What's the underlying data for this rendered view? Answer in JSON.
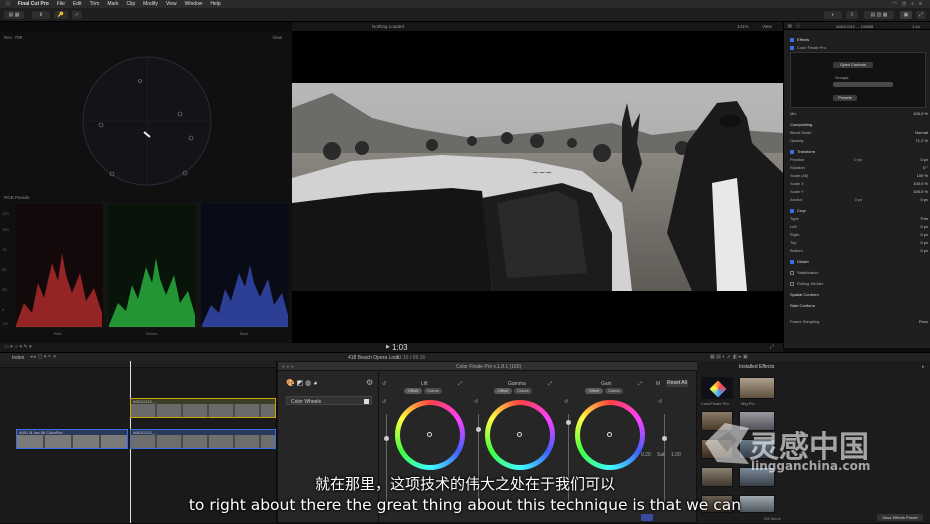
{
  "menubar": {
    "app": "Final Cut Pro",
    "items": [
      "File",
      "Edit",
      "Trim",
      "Mark",
      "Clip",
      "Modify",
      "View",
      "Window",
      "Help"
    ]
  },
  "viewer": {
    "status": "Nothing Loaded",
    "zoom": "141%",
    "view_label": "View",
    "timecode": "1:03"
  },
  "scopes": {
    "vectorscope_label": "Rec. 709",
    "vectorscope_view": "View",
    "parade_label": "RGB Parade",
    "ticks": [
      "120",
      "100",
      "75",
      "50",
      "25",
      "0",
      "-20"
    ],
    "channels": [
      "Red",
      "Green",
      "Blue"
    ]
  },
  "inspector": {
    "title": "A001C012 ... 100MB",
    "duration": "1:14",
    "effects_label": "Effects",
    "plugin_name": "Color Finale Pro",
    "open_controls": "Open Controls",
    "groups_label": "Groups:",
    "presets_label": "Presets",
    "mix_label": "Mix",
    "mix_value": "100.0 %",
    "compositing": "Compositing",
    "blend_mode_label": "Blend Mode",
    "blend_mode_value": "Normal",
    "opacity_label": "Opacity",
    "opacity_value": "71.2 %",
    "transform": "Transform",
    "position_label": "Position",
    "position_x": "0 px",
    "position_y": "0 px",
    "rotation_label": "Rotation",
    "rotation_value": "0 °",
    "scale_all_label": "Scale (All)",
    "scale_all_value": "100 %",
    "scale_x_label": "Scale X",
    "scale_x_value": "100.0 %",
    "scale_y_label": "Scale Y",
    "scale_y_value": "100.0 %",
    "anchor_label": "Anchor",
    "anchor_x": "0 px",
    "anchor_y": "0 px",
    "crop": "Crop",
    "crop_type_label": "Type",
    "crop_type_value": "Trim",
    "left_label": "Left",
    "left_value": "0 px",
    "right_label": "Right",
    "right_value": "0 px",
    "top_label": "Top",
    "top_value": "0 px",
    "bottom_label": "Bottom",
    "bottom_value": "0 px",
    "distort": "Distort",
    "stabilization": "Stabilization",
    "rolling_shutter": "Rolling Shutter",
    "spatial_conform": "Spatial Conform",
    "rate_conform": "Rate Conform",
    "frame_sampling_label": "Frame Sampling",
    "frame_sampling_value": "Floor",
    "save_preset": "Save Effects Preset"
  },
  "timeline": {
    "index_label": "Index",
    "title": "418 Beach Opera Look",
    "duration": "01:16 / 05:16",
    "clip_upper": "A001C012_...",
    "clip_lower_a": "A001 B Jan 08 ColorFinl",
    "clip_lower_b": "A001C012_..."
  },
  "plugin": {
    "title": "Color Finale Pro v.1.8.1 (160)",
    "layer_name": "Color Wheels",
    "wheels": [
      {
        "name": "Lift",
        "mode_a": "Offset",
        "mode_b": "Colors"
      },
      {
        "name": "Gamma",
        "mode_a": "Offset",
        "mode_b": "Colors"
      },
      {
        "name": "Gain",
        "mode_a": "Offset",
        "mode_b": "Colors"
      }
    ],
    "reset_all": "Reset All",
    "sat_label": "Sat",
    "sat_value": "1.00",
    "val_label": "0.20"
  },
  "effects": {
    "title": "Installed Effects",
    "items": [
      "ColorFinale Pro",
      "Mtg Pin"
    ],
    "count": "755 Items"
  },
  "subtitles": {
    "zh": "就在那里，这项技术的伟大之处在于我们可以",
    "en": "to right about there the great thing about this technique is that we can"
  },
  "watermark": {
    "brand": "灵感中国",
    "domain": "lingganchina.com"
  },
  "colors": {
    "accent": "#3a6fe0",
    "red_trace": "#ff3b3b",
    "green_trace": "#3bff5a",
    "blue_trace": "#4a6bff"
  }
}
